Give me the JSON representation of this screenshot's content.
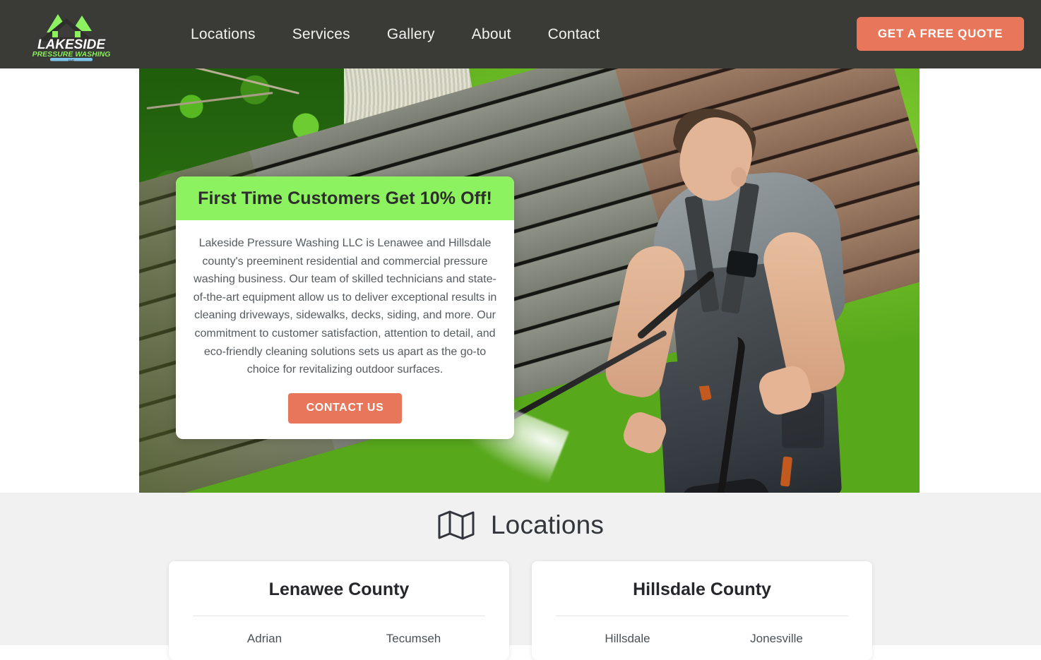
{
  "header": {
    "logo": {
      "name": "LAKESIDE",
      "subtitle": "PRESSURE WASHING",
      "suffix": "LLC"
    },
    "nav": [
      {
        "label": "Locations"
      },
      {
        "label": "Services"
      },
      {
        "label": "Gallery"
      },
      {
        "label": "About"
      },
      {
        "label": "Contact"
      }
    ],
    "cta_label": "GET A FREE QUOTE",
    "background_color": "#3a3a37",
    "cta_color": "#e8765a"
  },
  "hero": {
    "offer": {
      "headline": "First Time Customers Get 10% Off!",
      "banner_color": "#8cf25f",
      "body": "Lakeside Pressure Washing LLC is Lenawee and Hillsdale county's preeminent residential and commercial pressure washing business. Our team of skilled technicians and state-of-the-art equipment allow us to deliver exceptional results in cleaning driveways, sidewalks, decks, siding, and more. Our commitment to customer satisfaction, attention to detail, and eco-friendly cleaning solutions sets us apart as the go-to choice for revitalizing outdoor surfaces.",
      "button_label": "CONTACT US",
      "button_color": "#e8765a"
    },
    "image_alt": "Worker pressure washing a wooden deck beside a green lawn"
  },
  "locations": {
    "title": "Locations",
    "icon": "map-icon",
    "background_color": "#f1f1f1",
    "counties": [
      {
        "name": "Lenawee County",
        "cities": [
          "Adrian",
          "Tecumseh"
        ]
      },
      {
        "name": "Hillsdale County",
        "cities": [
          "Hillsdale",
          "Jonesville"
        ]
      }
    ]
  }
}
